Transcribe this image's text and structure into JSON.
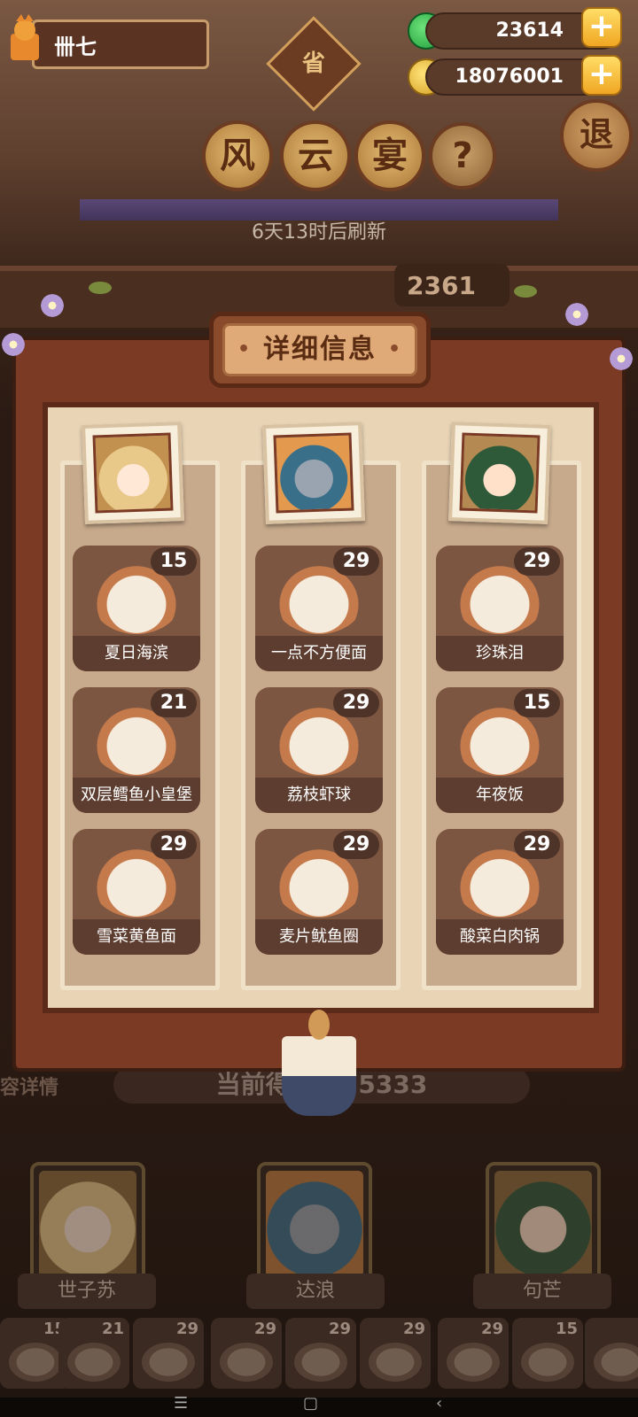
{
  "player": {
    "name": "卌七"
  },
  "currency": {
    "jade": "23614",
    "coins": "18076001"
  },
  "badge": "省",
  "event_title": [
    "风",
    "云",
    "宴"
  ],
  "help_label": "?",
  "exit_label": "退",
  "refresh_text": "6天13时后刷新",
  "score_partial": "2361",
  "panel": {
    "title": "详细信息",
    "columns": [
      {
        "dishes": [
          {
            "name": "夏日海滨",
            "count": "15"
          },
          {
            "name": "双层鳕鱼小皇堡",
            "count": "21"
          },
          {
            "name": "雪菜黄鱼面",
            "count": "29"
          }
        ]
      },
      {
        "dishes": [
          {
            "name": "一点不方便面",
            "count": "29"
          },
          {
            "name": "荔枝虾球",
            "count": "29"
          },
          {
            "name": "麦片鱿鱼圈",
            "count": "29"
          }
        ]
      },
      {
        "dishes": [
          {
            "name": "珍珠泪",
            "count": "29"
          },
          {
            "name": "年夜饭",
            "count": "15"
          },
          {
            "name": "酸菜白肉锅",
            "count": "29"
          }
        ]
      }
    ]
  },
  "background": {
    "team_details": "容详情",
    "current_score": "当前得分 975333",
    "characters": [
      "世子苏",
      "达浪",
      "句芒"
    ],
    "mini_dishes": [
      "15",
      "21",
      "29",
      "29",
      "29",
      "29",
      "29",
      "15",
      ""
    ]
  },
  "colors": {
    "panel": "#7a3a24",
    "panel_inner": "#e9d4b5",
    "dish_card": "#7d5642",
    "plus_button": "#f0a623"
  }
}
